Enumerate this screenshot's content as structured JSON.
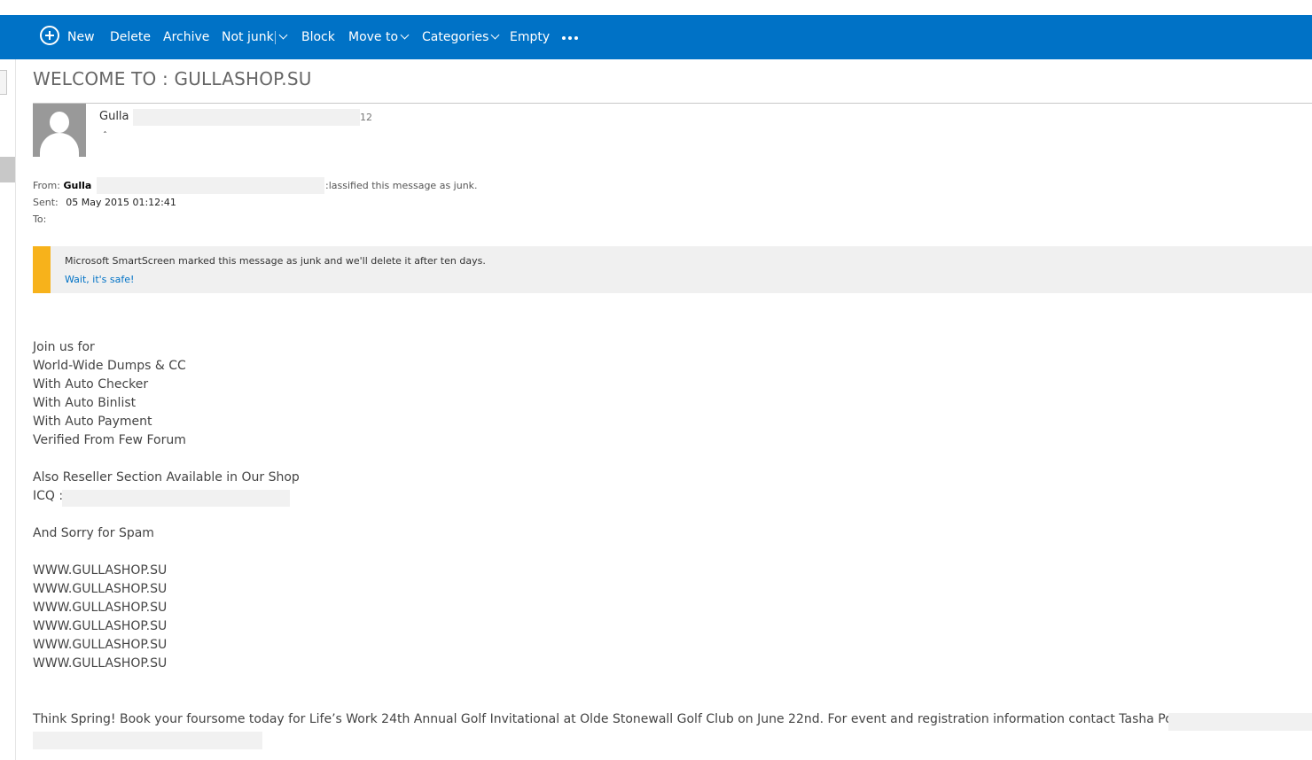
{
  "toolbar": {
    "new_label": "New",
    "delete_label": "Delete",
    "archive_label": "Archive",
    "notjunk_label": "Not junk",
    "block_label": "Block",
    "moveto_label": "Move to",
    "categories_label": "Categories",
    "empty_label": "Empty",
    "more_icon": "ellipsis-icon",
    "bg_color": "#0072c6"
  },
  "message": {
    "subject": "WELCOME TO : GULLASHOP.SU",
    "sender_name": "Gulla",
    "date_tail": "12",
    "expand_glyph": "ˆ",
    "from_label": "From:",
    "from_name": "Gulla",
    "classified_note": ":lassified this message as junk.",
    "sent_label": "Sent:",
    "sent_value": "05 May 2015 01:12:41",
    "to_label": "To:"
  },
  "junk_banner": {
    "message": "Microsoft SmartScreen marked this message as junk and we'll delete it after ten days.",
    "link": "Wait, it's safe!",
    "accent_color": "#f7b21b"
  },
  "body": {
    "lines": [
      "Join us for",
      "World-Wide Dumps & CC",
      "With Auto Checker",
      "With Auto Binlist",
      "With Auto Payment",
      "Verified From Few Forum",
      "Also Reseller Section Available in Our Shop",
      "ICQ :",
      "And Sorry for Spam",
      "WWW.GULLASHOP.SU",
      "WWW.GULLASHOP.SU",
      "WWW.GULLASHOP.SU",
      "WWW.GULLASHOP.SU",
      "WWW.GULLASHOP.SU",
      "WWW.GULLASHOP.SU",
      "Think Spring! Book your foursome today for Life’s Work 24th Annual Golf Invitational at Olde Stonewall Golf Club on June 22nd. For event and registration information contact Tasha Pokrzywa at"
    ]
  }
}
